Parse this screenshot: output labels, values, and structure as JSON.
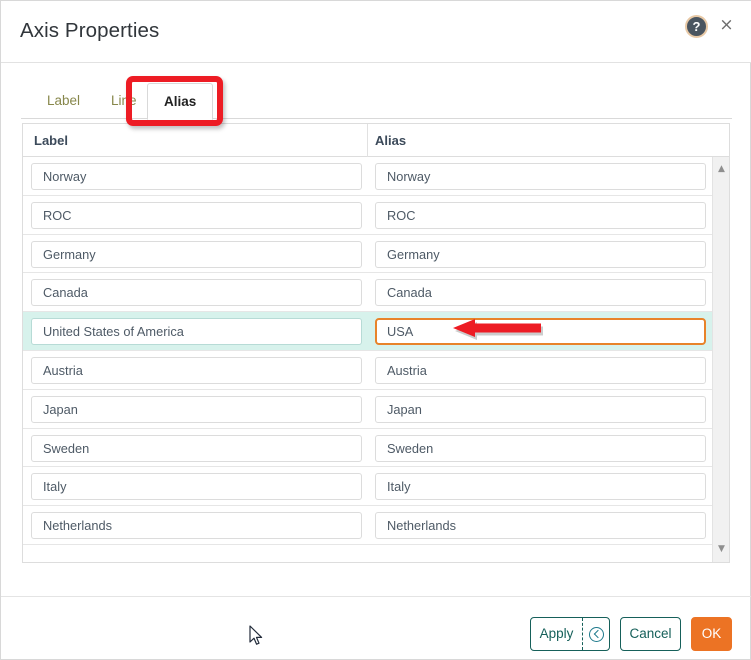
{
  "dialog": {
    "title": "Axis Properties",
    "help_icon": "help-question-icon",
    "help_label": "?",
    "close_icon": "close-x-icon",
    "close_label": "×"
  },
  "tabs": [
    {
      "label": "Label",
      "active": false
    },
    {
      "label": "Line",
      "active": false
    },
    {
      "label": "Alias",
      "active": true
    }
  ],
  "table": {
    "columns": [
      "Label",
      "Alias"
    ],
    "rows": [
      {
        "label": "Norway",
        "alias": "Norway",
        "selected": false
      },
      {
        "label": "ROC",
        "alias": "ROC",
        "selected": false
      },
      {
        "label": "Germany",
        "alias": "Germany",
        "selected": false
      },
      {
        "label": "Canada",
        "alias": "Canada",
        "selected": false
      },
      {
        "label": "United States of America",
        "alias": "USA",
        "selected": true
      },
      {
        "label": "Austria",
        "alias": "Austria",
        "selected": false
      },
      {
        "label": "Japan",
        "alias": "Japan",
        "selected": false
      },
      {
        "label": "Sweden",
        "alias": "Sweden",
        "selected": false
      },
      {
        "label": "Italy",
        "alias": "Italy",
        "selected": false
      },
      {
        "label": "Netherlands",
        "alias": "Netherlands",
        "selected": false
      }
    ]
  },
  "scrollbar": {
    "up_arrow": "▲",
    "down_arrow": "▼"
  },
  "footer": {
    "apply_label": "Apply",
    "apply_history_icon": "circle-back-arrow-icon",
    "cancel_label": "Cancel",
    "ok_label": "OK"
  },
  "annotations": {
    "highlight_rect_target": "Alias tab",
    "arrow_target": "USA alias field",
    "color": "#ed1c24"
  },
  "colors": {
    "accent_orange": "#ec7324",
    "button_teal": "#16605a",
    "selected_row": "#d7f2ec",
    "focus_orange": "#e8832a",
    "tab_inactive": "#87874b",
    "annotation_red": "#ed1c24"
  }
}
